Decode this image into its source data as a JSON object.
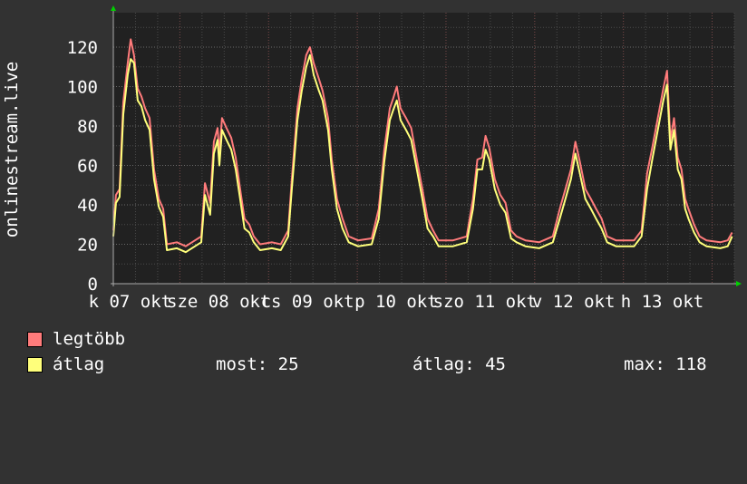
{
  "chart_data": {
    "type": "line",
    "title": "",
    "ylabel": "onlinestream.live",
    "xlabel": "",
    "ylim": [
      0,
      137.5
    ],
    "xlim_hours": [
      0,
      168
    ],
    "yticks": [
      0,
      20,
      40,
      60,
      80,
      100,
      120
    ],
    "grid": true,
    "day_starts_hours": [
      18,
      42,
      66,
      90,
      114,
      138,
      162
    ],
    "xtick_labels": [
      "k 07 okt",
      "sze 08 okt",
      "cs 09 okt",
      "p 10 okt",
      "szo 11 okt",
      "v 12 okt",
      "h 13 okt"
    ],
    "x_hours": [
      0,
      0.7,
      1.7,
      2.7,
      3.9,
      4.7,
      5.6,
      6.6,
      7.6,
      8.6,
      9.8,
      11,
      12.3,
      13.5,
      14.5,
      17.2,
      19.6,
      22.1,
      23.8,
      24.8,
      26.2,
      27.2,
      28.2,
      28.7,
      29.4,
      30.6,
      31.9,
      33.1,
      34.3,
      35.5,
      36.8,
      38,
      39.7,
      42.9,
      45.3,
      47.3,
      48.3,
      49.8,
      51,
      52.2,
      53.2,
      54.2,
      55.6,
      56.6,
      58.1,
      59.1,
      60.5,
      62,
      63.7,
      66.2,
      69.9,
      71.8,
      73.3,
      74.8,
      75.7,
      76.7,
      77.7,
      79.2,
      80.6,
      82.1,
      83.6,
      85,
      86.5,
      88,
      91.9,
      95.6,
      97.3,
      98.5,
      99.8,
      100.7,
      101.7,
      103.2,
      104.7,
      106.1,
      107.6,
      109.1,
      111.5,
      115.2,
      118.9,
      120.8,
      122.3,
      123.8,
      125,
      126.2,
      127.7,
      129.2,
      130.6,
      132.1,
      133.6,
      136,
      140.9,
      142.9,
      144.4,
      145.8,
      147.3,
      148.8,
      149.8,
      150.7,
      151.7,
      152.7,
      153.7,
      154.7,
      155.6,
      157.1,
      158.6,
      160.5,
      164.2,
      166.2,
      167.4
    ],
    "series": [
      {
        "name": "legtöbb",
        "color": "#ff7b7b",
        "values": [
          27,
          45,
          48,
          92,
          112,
          124,
          116,
          99,
          95,
          89,
          84,
          58,
          43,
          38,
          20,
          21,
          19,
          22,
          24,
          51,
          41,
          72,
          79,
          66,
          84,
          79,
          74,
          64,
          48,
          33,
          30,
          24,
          20,
          21,
          20,
          27,
          53,
          89,
          104,
          116,
          120,
          112,
          104,
          98,
          84,
          63,
          43,
          33,
          24,
          22,
          23,
          38,
          68,
          89,
          94,
          100,
          89,
          84,
          79,
          63,
          48,
          33,
          27,
          22,
          22,
          24,
          43,
          63,
          64,
          75,
          69,
          53,
          45,
          41,
          27,
          24,
          22,
          21,
          24,
          38,
          48,
          58,
          72,
          62,
          48,
          43,
          38,
          33,
          24,
          22,
          22,
          27,
          56,
          69,
          84,
          99,
          108,
          73,
          84,
          64,
          58,
          43,
          38,
          30,
          24,
          22,
          21,
          22,
          26
        ]
      },
      {
        "name": "átlag",
        "color": "#ffff7b",
        "values": [
          24,
          41,
          44,
          86,
          106,
          114,
          112,
          93,
          90,
          83,
          78,
          53,
          39,
          34,
          17,
          18,
          16,
          19,
          21,
          45,
          35,
          66,
          73,
          60,
          78,
          73,
          68,
          58,
          43,
          28,
          26,
          21,
          17,
          18,
          17,
          24,
          48,
          83,
          98,
          110,
          116,
          106,
          98,
          93,
          78,
          58,
          38,
          28,
          21,
          19,
          20,
          33,
          62,
          83,
          88,
          93,
          83,
          78,
          73,
          58,
          43,
          28,
          24,
          19,
          19,
          21,
          38,
          58,
          58,
          68,
          63,
          48,
          40,
          36,
          23,
          21,
          19,
          18,
          21,
          33,
          43,
          53,
          66,
          56,
          43,
          38,
          33,
          28,
          21,
          19,
          19,
          24,
          48,
          63,
          78,
          93,
          101,
          68,
          78,
          58,
          53,
          38,
          33,
          26,
          21,
          19,
          18,
          19,
          24
        ]
      }
    ]
  },
  "legend": {
    "items": [
      {
        "label": "legtöbb",
        "color": "#ff7b7b"
      },
      {
        "label": "átlag",
        "color": "#ffff7b"
      }
    ],
    "stats": {
      "current": "most: 25",
      "average": "átlag: 45",
      "max": "max: 118"
    }
  },
  "colors": {
    "background": "#323232",
    "plot": "#212121",
    "grid": "#5a5a5a",
    "major_grid": "#7a4a4a",
    "arrow": "#00d000"
  }
}
